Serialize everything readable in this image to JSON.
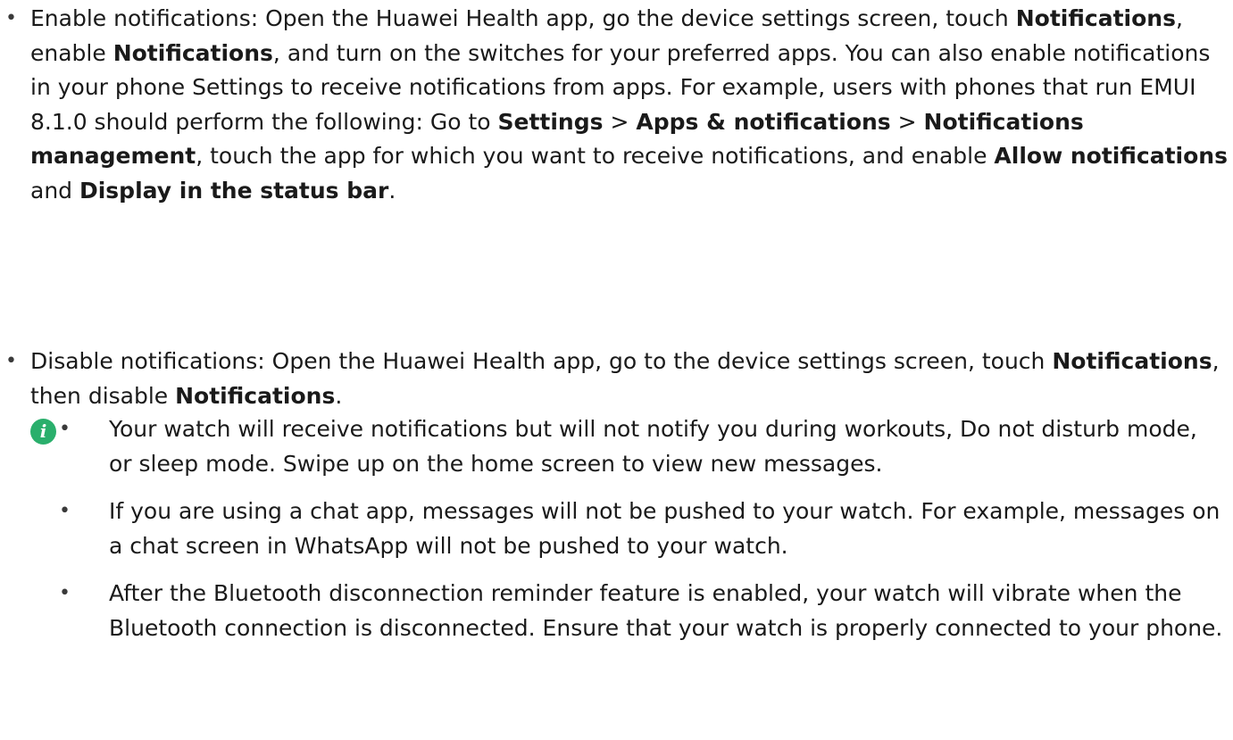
{
  "items": [
    {
      "bullet": "•",
      "segments": [
        {
          "text": "Enable notifications: Open the Huawei Health app, go the device settings screen, touch ",
          "bold": false
        },
        {
          "text": "Notifications",
          "bold": true
        },
        {
          "text": ", enable ",
          "bold": false
        },
        {
          "text": "Notifications",
          "bold": true
        },
        {
          "text": ", and turn on the switches for your preferred apps. You can also enable notifications in your phone Settings to receive notifications from apps. For example, users with phones that run EMUI 8.1.0 should perform the following: Go to ",
          "bold": false
        },
        {
          "text": "Settings",
          "bold": true
        },
        {
          "text": " > ",
          "bold": false
        },
        {
          "text": "Apps & notifications",
          "bold": true
        },
        {
          "text": " > ",
          "bold": false
        },
        {
          "text": "Notifications management",
          "bold": true
        },
        {
          "text": ", touch the app for which you want to receive notifications, and enable ",
          "bold": false
        },
        {
          "text": "Allow notifications",
          "bold": true
        },
        {
          "text": " and ",
          "bold": false
        },
        {
          "text": "Display in the status bar",
          "bold": true
        },
        {
          "text": ".",
          "bold": false
        }
      ]
    },
    {
      "bullet": "•",
      "segments": [
        {
          "text": "Disable notifications: Open the Huawei Health app, go to the device settings screen, touch ",
          "bold": false
        },
        {
          "text": "Notifications",
          "bold": true
        },
        {
          "text": ", then disable ",
          "bold": false
        },
        {
          "text": "Notifications",
          "bold": true
        },
        {
          "text": ".",
          "bold": false
        }
      ]
    }
  ],
  "note": {
    "icon": "info-icon",
    "icon_glyph": "i",
    "icon_color": "#2aaf6c",
    "items": [
      {
        "bullet": "•",
        "text": "Your watch will receive notifications but will not notify you during workouts, Do not disturb mode, or sleep mode. Swipe up on the home screen to view new messages."
      },
      {
        "bullet": "•",
        "text": "If you are using a chat app, messages will not be pushed to your watch. For example, messages on a chat screen in WhatsApp will not be pushed to your watch."
      },
      {
        "bullet": "•",
        "text": "After the Bluetooth disconnection reminder feature is enabled, your watch will vibrate when the Bluetooth connection is disconnected. Ensure that your watch is properly connected to your phone."
      }
    ]
  }
}
